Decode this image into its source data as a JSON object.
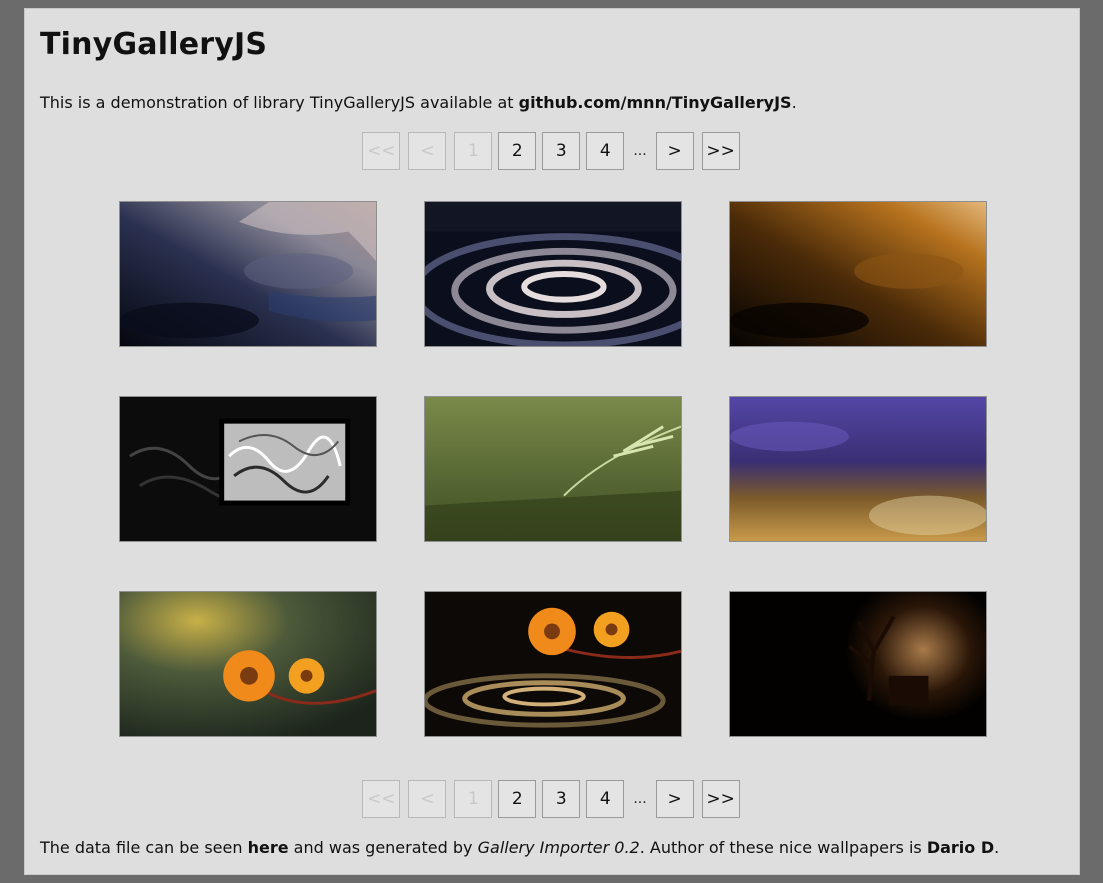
{
  "title": "TinyGalleryJS",
  "intro": {
    "text": "This is a demonstration of library TinyGalleryJS available at ",
    "link": "github.com/mnn/TinyGalleryJS",
    "end": "."
  },
  "pager": {
    "first": "<<",
    "prev": "<",
    "pages": [
      "1",
      "2",
      "3",
      "4"
    ],
    "current": "1",
    "ellipsis": "...",
    "next": ">",
    "last": ">>"
  },
  "thumbnails": [
    {
      "name": "thumb-dark-blue-water"
    },
    {
      "name": "thumb-silver-ripples"
    },
    {
      "name": "thumb-amber-water"
    },
    {
      "name": "thumb-framed-smoke"
    },
    {
      "name": "thumb-green-grass"
    },
    {
      "name": "thumb-purple-golden-water"
    },
    {
      "name": "thumb-orange-flowers-blurred"
    },
    {
      "name": "thumb-orange-flowers-ripples"
    },
    {
      "name": "thumb-dark-tree"
    }
  ],
  "footer": {
    "t1": "The data file can be seen ",
    "here": "here",
    "t2": " and was generated by ",
    "importer": "Gallery Importer 0.2",
    "t3": ". Author of these nice wallpapers is ",
    "author": "Dario D",
    "t4": "."
  }
}
